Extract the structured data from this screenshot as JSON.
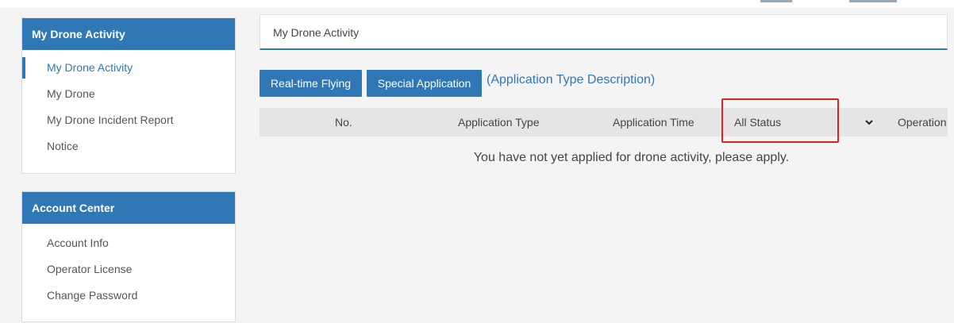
{
  "sidebar": {
    "drone_panel": {
      "title": "My Drone Activity",
      "items": [
        {
          "label": "My Drone Activity",
          "active": true
        },
        {
          "label": "My Drone",
          "active": false
        },
        {
          "label": "My Drone Incident Report",
          "active": false
        },
        {
          "label": "Notice",
          "active": false
        }
      ]
    },
    "account_panel": {
      "title": "Account Center",
      "items": [
        {
          "label": "Account Info"
        },
        {
          "label": "Operator License"
        },
        {
          "label": "Change Password"
        }
      ]
    }
  },
  "main": {
    "breadcrumb": "My Drone Activity",
    "buttons": {
      "realtime": "Real-time Flying",
      "special": "Special Application"
    },
    "type_description_link": "(Application Type Description)",
    "table": {
      "columns": {
        "no": "No.",
        "application_type": "Application Type",
        "application_time": "Application Time",
        "status_filter": "All Status",
        "operation": "Operation"
      },
      "empty_message": "You have not yet applied for drone activity, please apply."
    }
  },
  "colors": {
    "accent": "#2f78b5",
    "highlight": "#e02020",
    "table_header_bg": "#e5e5e5",
    "page_bg": "#f4f4f4"
  }
}
